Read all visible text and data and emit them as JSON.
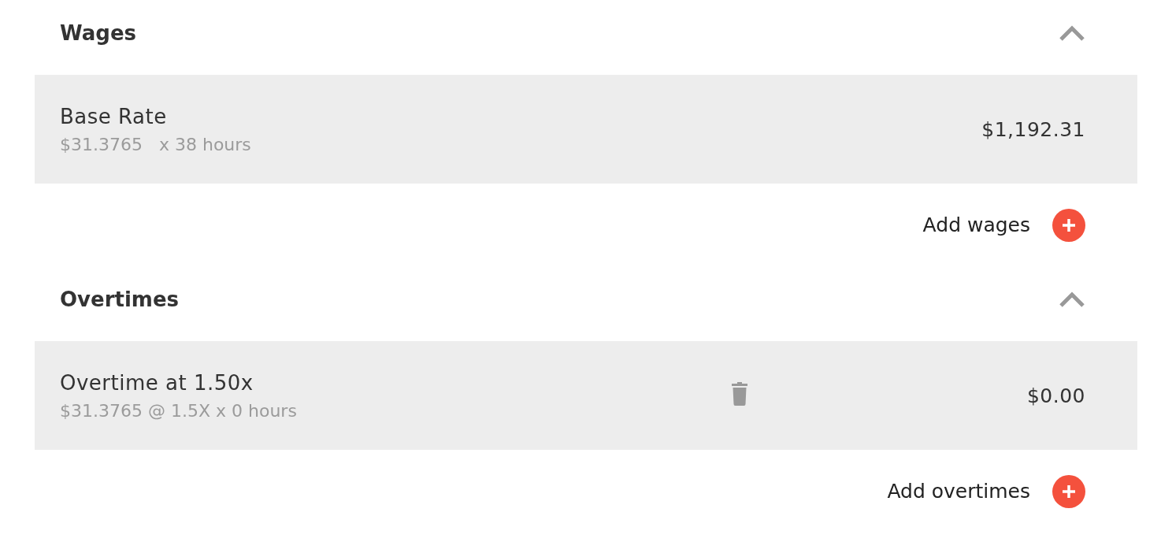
{
  "sections": [
    {
      "title": "Wages",
      "expanded": true,
      "items": [
        {
          "name": "Base Rate",
          "detail": "$31.3765   x 38 hours",
          "amount": "$1,192.31",
          "deletable": false
        }
      ],
      "add_label": "Add wages"
    },
    {
      "title": "Overtimes",
      "expanded": true,
      "items": [
        {
          "name": "Overtime at 1.50x",
          "detail": "$31.3765 @ 1.5X x 0 hours",
          "amount": "$0.00",
          "deletable": true
        }
      ],
      "add_label": "Add overtimes"
    }
  ]
}
